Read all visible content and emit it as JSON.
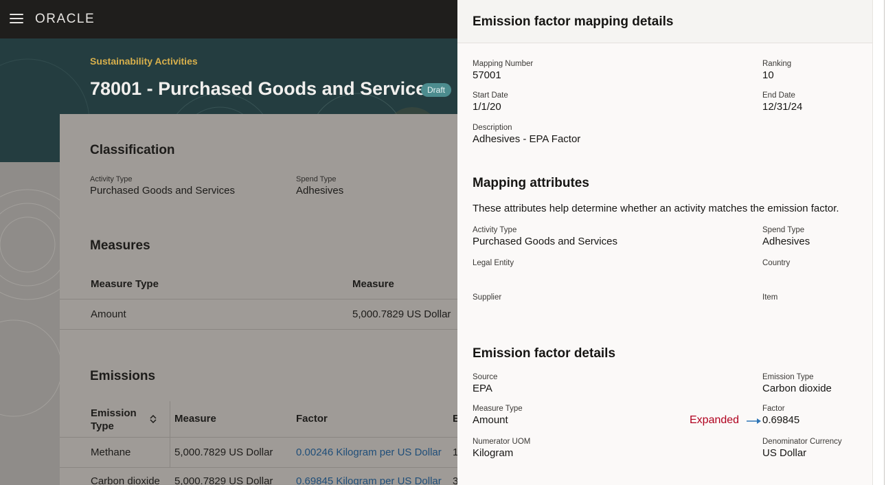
{
  "app": {
    "brand": "ORACLE"
  },
  "page": {
    "breadcrumb": "Sustainability Activities",
    "title": "78001 - Purchased Goods and Services",
    "status": "Draft"
  },
  "classification": {
    "title": "Classification",
    "activity_type_label": "Activity Type",
    "activity_type_value": "Purchased Goods and Services",
    "spend_type_label": "Spend Type",
    "spend_type_value": "Adhesives"
  },
  "measures": {
    "title": "Measures",
    "headers": [
      "Measure Type",
      "Measure"
    ],
    "rows": [
      {
        "measure_type": "Amount",
        "measure": "5,000.7829 US Dollar"
      }
    ]
  },
  "emissions": {
    "title": "Emissions",
    "headers": [
      "Emission Type",
      "Measure",
      "Factor",
      "E"
    ],
    "rows": [
      {
        "type": "Methane",
        "measure": "5,000.7829 US Dollar",
        "factor": "0.00246 Kilogram per US Dollar",
        "e": "1"
      },
      {
        "type": "Carbon dioxide",
        "measure": "5,000.7829 US Dollar",
        "factor": "0.69845 Kilogram per US Dollar",
        "e": "3"
      }
    ]
  },
  "drawer": {
    "title": "Emission factor mapping details",
    "mapping_number_label": "Mapping Number",
    "mapping_number_value": "57001",
    "ranking_label": "Ranking",
    "ranking_value": "10",
    "start_date_label": "Start Date",
    "start_date_value": "1/1/20",
    "end_date_label": "End Date",
    "end_date_value": "12/31/24",
    "description_label": "Description",
    "description_value": "Adhesives - EPA Factor",
    "attributes": {
      "title": "Mapping attributes",
      "intro": "These attributes help determine whether an activity matches the emission factor.",
      "activity_type_label": "Activity Type",
      "activity_type_value": "Purchased Goods and Services",
      "spend_type_label": "Spend Type",
      "spend_type_value": "Adhesives",
      "legal_entity_label": "Legal Entity",
      "country_label": "Country",
      "supplier_label": "Supplier",
      "item_label": "Item"
    },
    "factor_details": {
      "title": "Emission factor details",
      "source_label": "Source",
      "source_value": "EPA",
      "emission_type_label": "Emission Type",
      "emission_type_value": "Carbon dioxide",
      "measure_type_label": "Measure Type",
      "measure_type_value": "Amount",
      "factor_label": "Factor",
      "factor_value": "0.69845",
      "numerator_uom_label": "Numerator UOM",
      "numerator_uom_value": "Kilogram",
      "denominator_currency_label": "Denominator Currency",
      "denominator_currency_value": "US Dollar"
    }
  },
  "annotation": {
    "text": "Expanded",
    "color": "#b0001e",
    "arrow_color": "#2e75b6"
  },
  "icons": {
    "menu": "hamburger-menu-icon",
    "sort": "sort-icon"
  }
}
